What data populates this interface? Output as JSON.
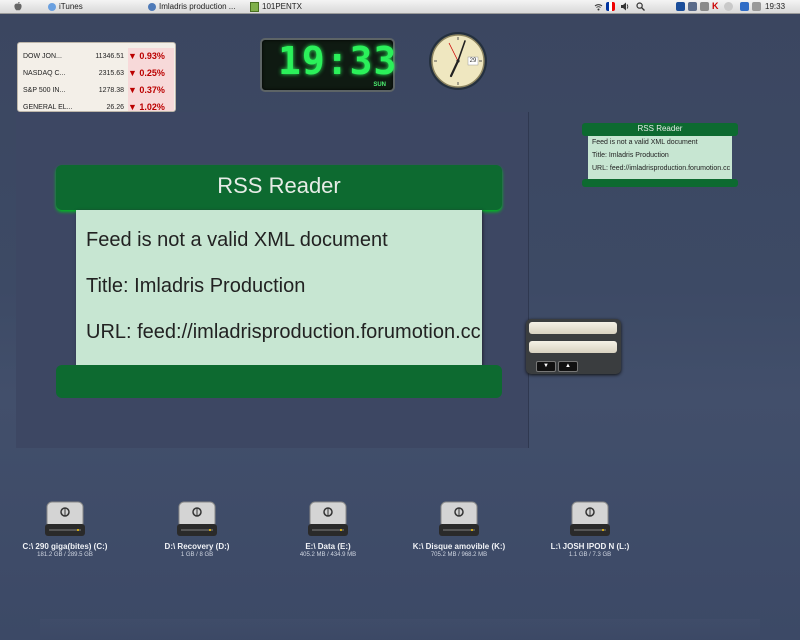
{
  "menubar": {
    "apps": [
      {
        "label": "iTunes"
      },
      {
        "label": "Imladris production ..."
      },
      {
        "label": "101PENTX"
      }
    ],
    "clock": "19:33"
  },
  "stocks": [
    {
      "name": "DOW JON...",
      "price": "11346.51",
      "change": "▼ 0.93%"
    },
    {
      "name": "NASDAQ C...",
      "price": "2315.63",
      "change": "▼ 0.25%"
    },
    {
      "name": "S&P 500 IN...",
      "price": "1278.38",
      "change": "▼ 0.37%"
    },
    {
      "name": "GENERAL EL...",
      "price": "26.26",
      "change": "▼ 1.02%"
    }
  ],
  "digital_clock": {
    "time": "19:33",
    "day": "SUN"
  },
  "analog_clock": {
    "date": "29"
  },
  "rss_large": {
    "title": "RSS Reader",
    "lines": [
      "Feed is not a valid XML document",
      "Title: Imladris Production",
      "URL: feed://imladrisproduction.forumotion.cc"
    ]
  },
  "rss_small": {
    "title": "RSS Reader",
    "lines": [
      "Feed is not a valid XML document",
      "Title: Imladris Production",
      "URL: feed://imladrisproduction.forumotion.cc"
    ]
  },
  "drives": [
    {
      "name": "C:\\ 290 giga(bites) (C:)",
      "size": "181.2 GB / 289.5 GB"
    },
    {
      "name": "D:\\ Recovery (D:)",
      "size": "1 GB / 8 GB"
    },
    {
      "name": "E:\\ Data (E:)",
      "size": "405.2 MB / 434.9 MB"
    },
    {
      "name": "K:\\ Disque amovible (K:)",
      "size": "705.2 MB / 968.2 MB"
    },
    {
      "name": "L:\\ JOSH IPOD N (L:)",
      "size": "1.1 GB / 7.3 GB"
    }
  ],
  "colors": {
    "rss_green": "#0d6a30",
    "rss_body": "#c7e6d2",
    "clock_green": "#2bf05a",
    "desktop": "#3d4a65"
  }
}
